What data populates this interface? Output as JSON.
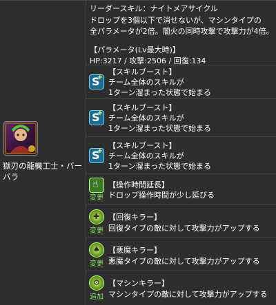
{
  "leader": {
    "line1": "リーダースキル：ナイトメアサイクル",
    "line2": "ドロップを3個以下で消せないが、マシンタイプの",
    "line3": "全パラメータが2倍。闇火の同時攻撃で攻撃力が4倍。",
    "params_heading": "【パラメータ(Lv最大時)】",
    "params_values": "HP:3217 / 攻撃:2506 / 回復:134"
  },
  "monster": {
    "name": "獄刃の龍機工士・バーバラ",
    "icon": "monster-portrait"
  },
  "awakenings": [
    {
      "icon": "skill-boost-icon",
      "title": "【スキルブースト】",
      "desc1": "チーム全体のスキルが",
      "desc2": "1ターン溜まった状態で始まる",
      "tag": ""
    },
    {
      "icon": "skill-boost-icon",
      "title": "【スキルブースト】",
      "desc1": "チーム全体のスキルが",
      "desc2": "1ターン溜まった状態で始まる",
      "tag": ""
    },
    {
      "icon": "skill-boost-icon",
      "title": "【スキルブースト】",
      "desc1": "チーム全体のスキルが",
      "desc2": "1ターン溜まった状態で始まる",
      "tag": ""
    },
    {
      "icon": "extend-time-icon",
      "title": "【操作時間延長】",
      "desc1": "ドロップ操作時間が少し延びる",
      "desc2": "",
      "tag": "変更"
    },
    {
      "icon": "healer-killer-icon",
      "title": "【回復キラー】",
      "desc1": "回復タイプの敵に対して攻撃力がアップする",
      "desc2": "",
      "tag": "変更"
    },
    {
      "icon": "devil-killer-icon",
      "title": "【悪魔キラー】",
      "desc1": "悪魔タイプの敵に対して攻撃力がアップする",
      "desc2": "",
      "tag": "変更"
    },
    {
      "icon": "machine-killer-icon",
      "title": "【マシンキラー】",
      "desc1": "マシンタイプの敵に対して攻撃力がアップする",
      "desc2": "",
      "tag": "追加"
    }
  ]
}
